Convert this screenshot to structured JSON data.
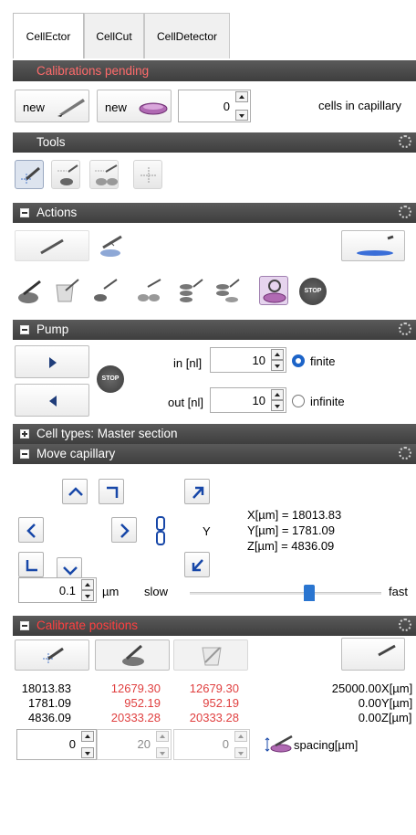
{
  "tabs": [
    "CellEctor",
    "CellCut",
    "CellDetector"
  ],
  "calib_pending": "Calibrations pending",
  "new_label": "new",
  "cells_value": "0",
  "cells_label": "cells in capillary",
  "sections": {
    "tools": "Tools",
    "actions": "Actions",
    "pump": "Pump",
    "cell_types": "Cell types: Master section",
    "move": "Move capillary",
    "calibrate": "Calibrate positions"
  },
  "pump": {
    "in_label": "in [nl]",
    "in_value": "10",
    "out_label": "out [nl]",
    "out_value": "10",
    "finite": "finite",
    "infinite": "infinite",
    "stop": "STOP"
  },
  "move": {
    "x": "X[µm] = 18013.83",
    "y": "Y[µm] = 1781.09",
    "z": "Z[µm] = 4836.09",
    "y_axis": "Y",
    "step": "0.1",
    "unit": "µm",
    "slow": "slow",
    "fast": "fast",
    "slider_fraction": 0.63
  },
  "calib": {
    "col1": [
      "18013.83",
      "1781.09",
      "4836.09"
    ],
    "col2": [
      "12679.30",
      "952.19",
      "20333.28"
    ],
    "col3": [
      "12679.30",
      "952.19",
      "20333.28"
    ],
    "col4": [
      "25000.00",
      "0.00",
      "0.00"
    ],
    "units": [
      "X[µm]",
      "Y[µm]",
      "Z[µm]"
    ],
    "spin1": "0",
    "spin2": "20",
    "spin3": "0",
    "spacing": "spacing[µm]"
  },
  "colors": {
    "accent_red": "#e04040",
    "header_bg": "#4a4a4a",
    "radio_blue": "#1d64c8"
  }
}
